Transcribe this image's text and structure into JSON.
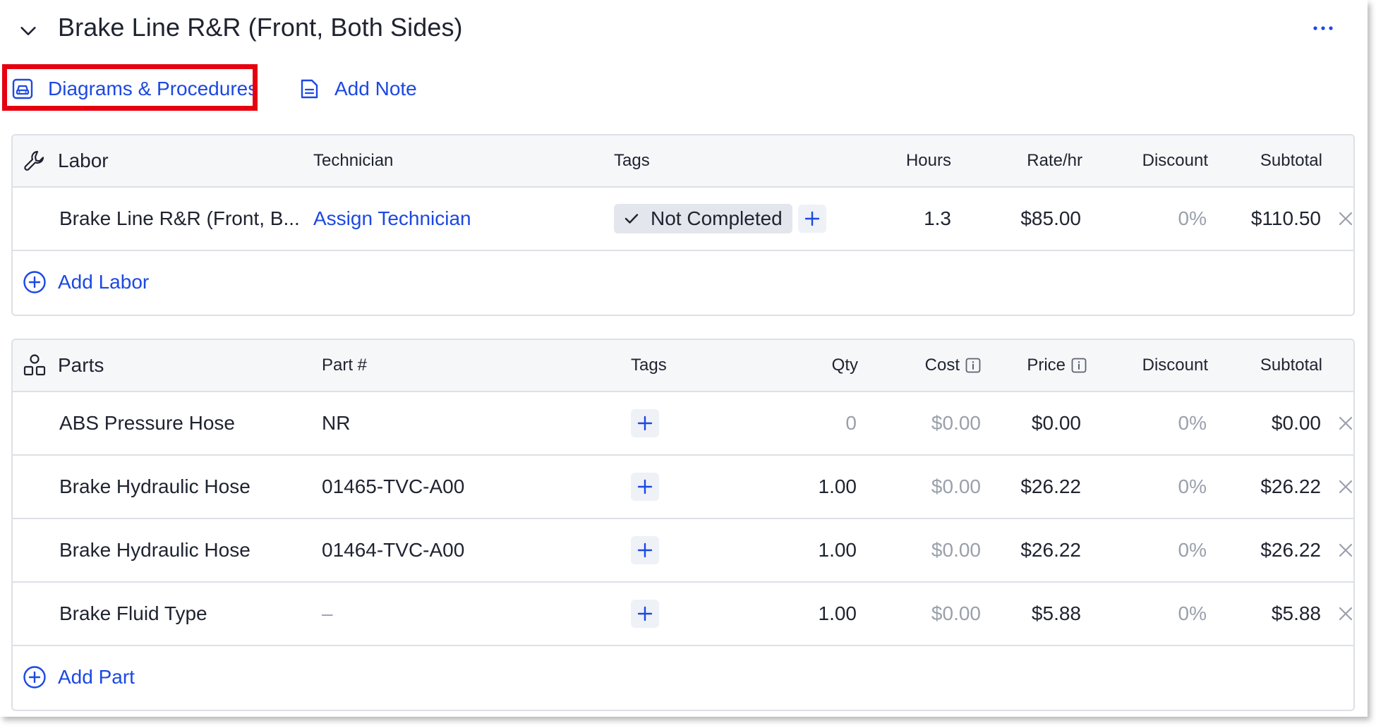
{
  "service": {
    "title": "Brake Line R&R (Front, Both Sides)",
    "collapse_icon": "chevron-down-icon",
    "more_icon": "ellipsis-icon"
  },
  "actions": {
    "diagrams_label": "Diagrams & Procedures",
    "note_label": "Add Note"
  },
  "labor": {
    "title": "Labor",
    "headers": {
      "technician": "Technician",
      "tags": "Tags",
      "hours": "Hours",
      "rate": "Rate/hr",
      "discount": "Discount",
      "subtotal": "Subtotal"
    },
    "rows": [
      {
        "name": "Brake Line R&R (Front, B...",
        "technician": "Assign Technician",
        "tag": "Not Completed",
        "hours": "1.3",
        "rate": "$85.00",
        "discount": "0%",
        "subtotal": "$110.50"
      }
    ],
    "add_label": "Add Labor"
  },
  "parts": {
    "title": "Parts",
    "headers": {
      "part_number": "Part #",
      "tags": "Tags",
      "qty": "Qty",
      "cost": "Cost",
      "price": "Price",
      "discount": "Discount",
      "subtotal": "Subtotal"
    },
    "rows": [
      {
        "name": "ABS Pressure Hose",
        "part_number": "NR",
        "qty": "0",
        "cost": "$0.00",
        "price": "$0.00",
        "discount": "0%",
        "subtotal": "$0.00"
      },
      {
        "name": "Brake Hydraulic Hose",
        "part_number": "01465-TVC-A00",
        "qty": "1.00",
        "cost": "$0.00",
        "price": "$26.22",
        "discount": "0%",
        "subtotal": "$26.22"
      },
      {
        "name": "Brake Hydraulic Hose",
        "part_number": "01464-TVC-A00",
        "qty": "1.00",
        "cost": "$0.00",
        "price": "$26.22",
        "discount": "0%",
        "subtotal": "$26.22"
      },
      {
        "name": "Brake Fluid Type",
        "part_number": "–",
        "qty": "1.00",
        "cost": "$0.00",
        "price": "$5.88",
        "discount": "0%",
        "subtotal": "$5.88"
      }
    ],
    "add_label": "Add Part"
  },
  "colors": {
    "accent": "#1c48e3",
    "highlight": "#e6000f",
    "muted_text": "#9aa0ab",
    "border": "#dde0e6",
    "tag_bg": "#e3e6ec"
  }
}
